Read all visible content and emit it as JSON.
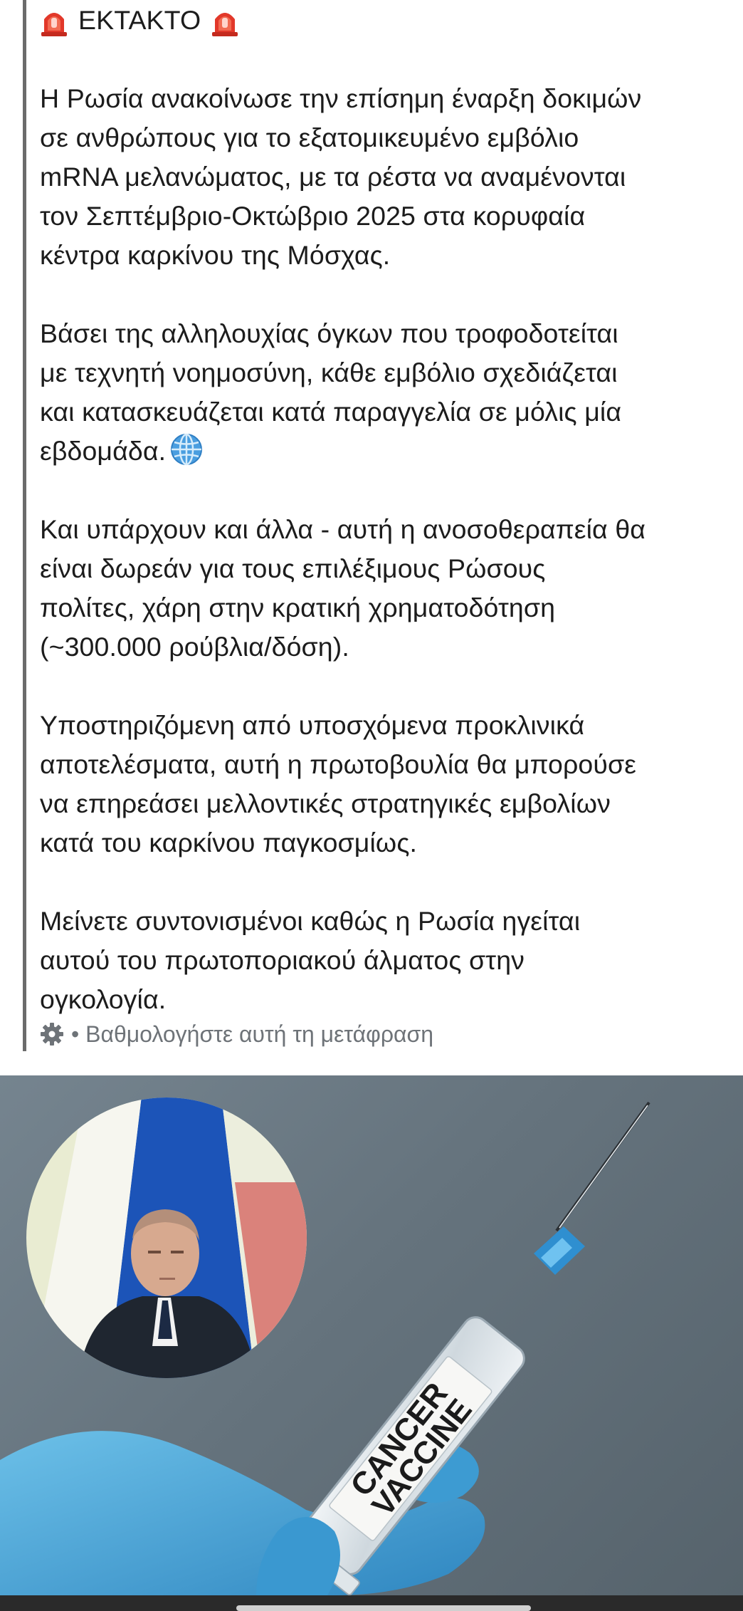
{
  "post": {
    "headline": "ΕΚΤΑΚΤΟ",
    "paragraphs": [
      [
        "Η Ρωσία ανακοίνωσε την επίσημη έναρξη δοκιμών",
        "σε ανθρώπους για το εξατομικευμένο εμβόλιο",
        "mRNA μελανώματος, με τα ρέστα να αναμένονται",
        "τον Σεπτέμβριο-Οκτώβριο 2025 στα κορυφαία",
        "κέντρα καρκίνου της Μόσχας."
      ],
      [
        "Βάσει της αλληλουχίας όγκων που τροφοδοτείται",
        "με τεχνητή νοημοσύνη, κάθε εμβόλιο σχεδιάζεται",
        "και κατασκευάζεται κατά παραγγελία σε μόλις μία",
        "εβδομάδα."
      ],
      [
        "Και υπάρχουν και άλλα - αυτή η ανοσοθεραπεία θα",
        "είναι δωρεάν για τους επιλέξιμους Ρώσους",
        "πολίτες, χάρη στην κρατική χρηματοδότηση",
        "(~300.000 ρούβλια/δόση)."
      ],
      [
        "Υποστηριζόμενη από υποσχόμενα προκλινικά",
        "αποτελέσματα, αυτή η πρωτοβουλία θα μπορούσε",
        "να επηρεάσει μελλοντικές στρατηγικές εμβολίων",
        "κατά του καρκίνου παγκοσμίως."
      ],
      [
        "Μείνετε συντονισμένοι καθώς η Ρωσία ηγείται",
        "αυτού του πρωτοποριακού άλματος στην",
        "ογκολογία."
      ]
    ],
    "icons": {
      "headline_left": "siren-icon",
      "headline_right": "siren-icon",
      "paragraph2_end": "globe-icon"
    }
  },
  "translation": {
    "rate_text": "• Βαθμολογήστε αυτή τη μετάφραση",
    "icon": "gear-icon"
  },
  "media": {
    "label_line1": "CANCER",
    "label_line2": "VACCINE"
  },
  "colors": {
    "text": "#1c1c1c",
    "muted": "#6e7378",
    "glove": "#4aa8d8",
    "needle_hub": "#2f8fd0"
  }
}
